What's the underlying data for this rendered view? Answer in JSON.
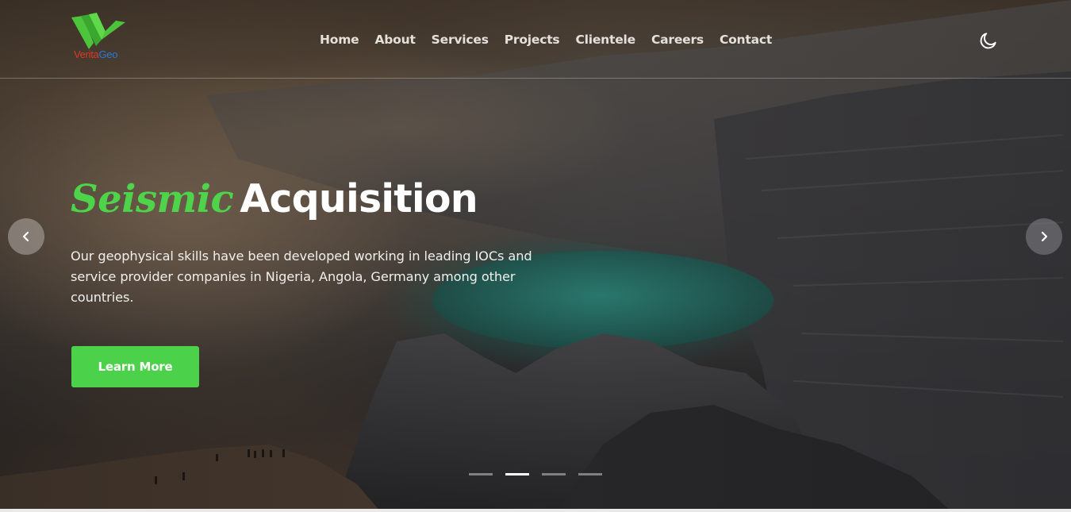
{
  "brand": {
    "logo_text_part1": "Verita",
    "logo_text_part2": "Geo",
    "logo_green": "#4cc53c",
    "logo_red": "#d83a2a",
    "logo_blue": "#2a7ad8"
  },
  "nav": {
    "items": [
      {
        "label": "Home"
      },
      {
        "label": "About"
      },
      {
        "label": "Services"
      },
      {
        "label": "Projects"
      },
      {
        "label": "Clientele"
      },
      {
        "label": "Careers"
      },
      {
        "label": "Contact"
      }
    ],
    "theme_toggle_icon": "moon-icon"
  },
  "hero": {
    "headline_accent": "Seismic",
    "headline_main": "Acquisition",
    "description": "Our geophysical skills have been developed working in leading IOCs and service provider companies in Nigeria, Angola, Germany among other countries.",
    "cta_label": "Learn More",
    "prev_icon": "chevron-left-icon",
    "next_icon": "chevron-right-icon",
    "slide_count": 4,
    "active_slide": 2
  },
  "colors": {
    "accent_green": "#4ed44a",
    "button_green": "#4cd14a",
    "text_white": "#ffffff"
  }
}
